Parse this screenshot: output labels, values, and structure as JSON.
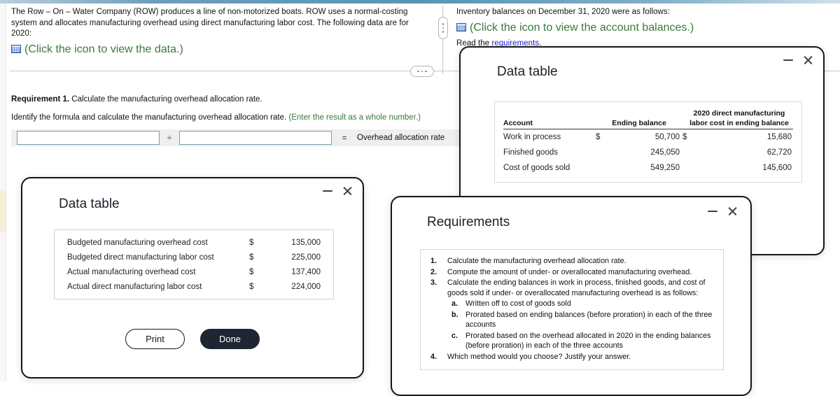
{
  "problem": {
    "left_paragraph": "The Row – On – Water Company (ROW) produces a line of non-motorized boats. ROW uses a normal-costing system and allocates manufacturing overhead using direct manufacturing labor cost. The following data are for 2020:",
    "left_icon_link": "(Click the icon to view the data.)",
    "right_paragraph": "Inventory balances on December 31, 2020 were as follows:",
    "right_icon_link": "(Click the icon to view the account balances.)",
    "read_prefix": "Read the ",
    "read_link": "requirements",
    "read_suffix": "."
  },
  "requirement1": {
    "heading_bold": "Requirement 1.",
    "heading_rest": " Calculate the manufacturing overhead allocation rate.",
    "instruction": "Identify the formula and calculate the manufacturing overhead allocation rate. ",
    "instruction_note": "(Enter the result as a whole number.)",
    "operator": "÷",
    "equals": "=",
    "result_label": "Overhead allocation rate",
    "input1_value": "",
    "input2_value": ""
  },
  "data_table_dialog": {
    "title": "Data table",
    "rows": [
      {
        "label": "Budgeted manufacturing overhead cost",
        "symbol": "$",
        "value": "135,000"
      },
      {
        "label": "Budgeted direct manufacturing labor cost",
        "symbol": "$",
        "value": "225,000"
      },
      {
        "label": "Actual manufacturing overhead cost",
        "symbol": "$",
        "value": "137,400"
      },
      {
        "label": "Actual direct manufacturing labor cost",
        "symbol": "$",
        "value": "224,000"
      }
    ],
    "print_label": "Print",
    "done_label": "Done"
  },
  "balances_dialog": {
    "title": "Data table",
    "header_col3_line1": "2020 direct manufacturing",
    "headers": [
      "Account",
      "Ending balance",
      "labor cost in ending balance"
    ],
    "rows": [
      {
        "account": "Work in process",
        "sym1": "$",
        "ending": "50,700",
        "sym2": "$",
        "labor": "15,680"
      },
      {
        "account": "Finished goods",
        "sym1": "",
        "ending": "245,050",
        "sym2": "",
        "labor": "62,720"
      },
      {
        "account": "Cost of goods sold",
        "sym1": "",
        "ending": "549,250",
        "sym2": "",
        "labor": "145,600"
      }
    ]
  },
  "requirements_dialog": {
    "title": "Requirements",
    "items": [
      {
        "num": "1.",
        "text": "Calculate the manufacturing overhead allocation rate.",
        "sub": false
      },
      {
        "num": "2.",
        "text": "Compute the amount of under- or overallocated manufacturing overhead.",
        "sub": false
      },
      {
        "num": "3.",
        "text": "Calculate the ending balances in work in process, finished goods, and cost of goods sold if under- or overallocated manufacturing overhead is as follows:",
        "sub": false
      },
      {
        "num": "a.",
        "text": "Written off to cost of goods sold",
        "sub": true
      },
      {
        "num": "b.",
        "text": "Prorated based on ending balances (before proration) in each of the three accounts",
        "sub": true
      },
      {
        "num": "c.",
        "text": "Prorated based on the overhead allocated in 2020 in the ending balances (before proration) in each of the three accounts",
        "sub": true
      },
      {
        "num": "4.",
        "text": "Which method would you choose? Justify your answer.",
        "sub": false
      }
    ]
  },
  "colors": {
    "accent_strip": "#5a93b4",
    "link_green": "#3b7a3b",
    "link_blue": "#2525cf",
    "button_dark": "#1f2533",
    "grid_icon": "#4a76c4"
  }
}
